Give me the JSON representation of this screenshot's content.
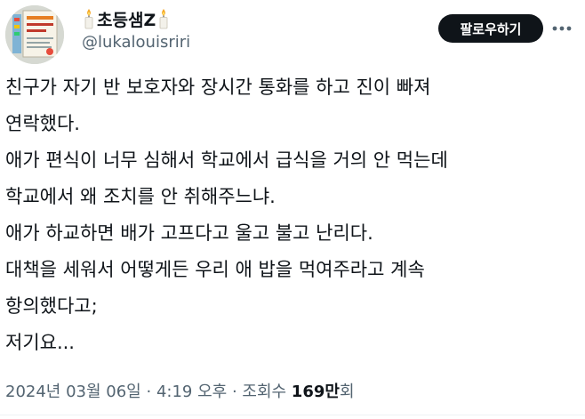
{
  "profile": {
    "display_name": "초등샘Z",
    "handle": "@lukalouisriri",
    "avatar_text": "초등샘 교실이야기",
    "left_emoji": "candle-icon",
    "right_emoji": "candle-icon"
  },
  "actions": {
    "follow_label": "팔로우하기",
    "more_icon": "more-horizontal-icon"
  },
  "tweet": {
    "lines": [
      "친구가 자기 반 보호자와 장시간 통화를 하고 진이 빠져",
      "연락했다.",
      "애가 편식이 너무 심해서 학교에서 급식을 거의 안 먹는데",
      "학교에서 왜 조치를 안 취해주느냐.",
      "애가 하교하면 배가 고프다고 울고 불고 난리다.",
      "대책을 세워서 어떻게든 우리 애 밥을 먹여주라고 계속",
      "항의했다고;",
      "저기요..."
    ]
  },
  "meta": {
    "date": "2024년 03월 06일",
    "separator": "·",
    "time": "4:19 오후",
    "views_label": "조회수",
    "views_count": "169만",
    "views_suffix": "회"
  },
  "colors": {
    "text": "#0f1419",
    "secondary": "#536471",
    "button_bg": "#0f1419",
    "button_text": "#ffffff"
  }
}
